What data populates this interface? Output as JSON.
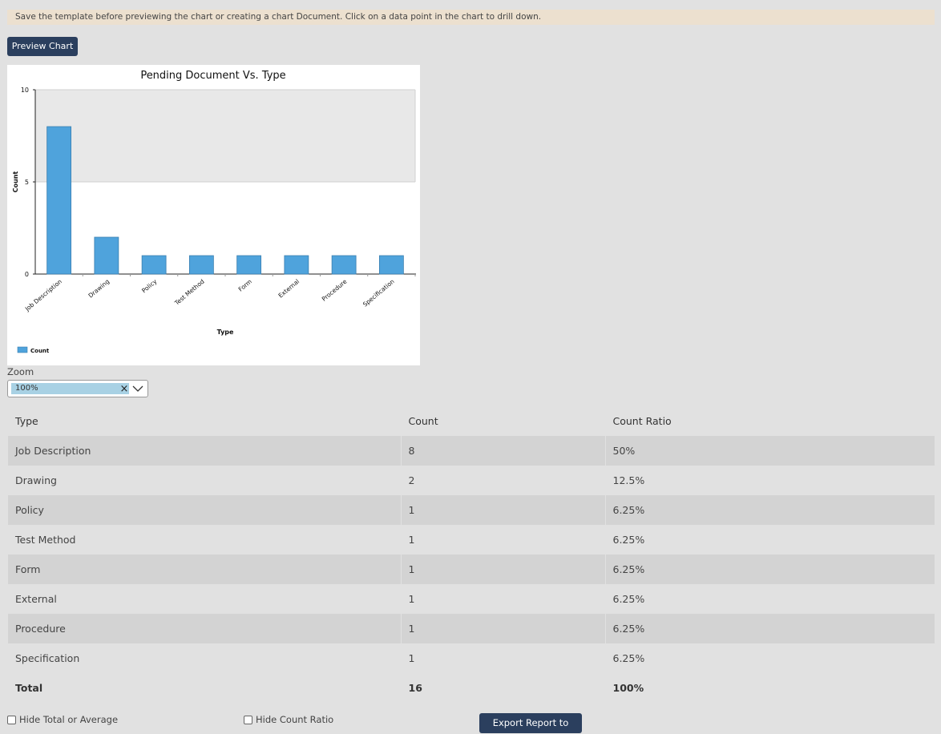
{
  "notice": "Save the template before previewing the chart or creating a chart Document. Click on a data point in the chart to drill down.",
  "preview_button": "Preview Chart",
  "chart_data": {
    "type": "bar",
    "title": "Pending Document Vs. Type",
    "xlabel": "Type",
    "ylabel": "Count",
    "categories": [
      "Job Description",
      "Drawing",
      "Policy",
      "Test Method",
      "Form",
      "External",
      "Procedure",
      "Specification"
    ],
    "series": [
      {
        "name": "Count",
        "values": [
          8,
          2,
          1,
          1,
          1,
          1,
          1,
          1
        ],
        "color": "#4fa3dc"
      }
    ],
    "ylim": [
      0,
      10
    ],
    "yticks": [
      0,
      5,
      10
    ],
    "legend": "bottom-left",
    "grid": false
  },
  "zoom": {
    "label": "Zoom",
    "value": "100%"
  },
  "table": {
    "headers": [
      "Type",
      "Count",
      "Count Ratio"
    ],
    "rows": [
      [
        "Job Description",
        "8",
        "50%"
      ],
      [
        "Drawing",
        "2",
        "12.5%"
      ],
      [
        "Policy",
        "1",
        "6.25%"
      ],
      [
        "Test Method",
        "1",
        "6.25%"
      ],
      [
        "Form",
        "1",
        "6.25%"
      ],
      [
        "External",
        "1",
        "6.25%"
      ],
      [
        "Procedure",
        "1",
        "6.25%"
      ],
      [
        "Specification",
        "1",
        "6.25%"
      ]
    ],
    "total": [
      "Total",
      "16",
      "100%"
    ]
  },
  "options": {
    "hide_total": "Hide Total or Average",
    "hide_ratio": "Hide Count Ratio"
  },
  "export_button": "Export Report to Excel",
  "colors": {
    "accent": "#2b3f5e",
    "bar": "#4fa3dc",
    "notice_bg": "#ece0cf"
  }
}
